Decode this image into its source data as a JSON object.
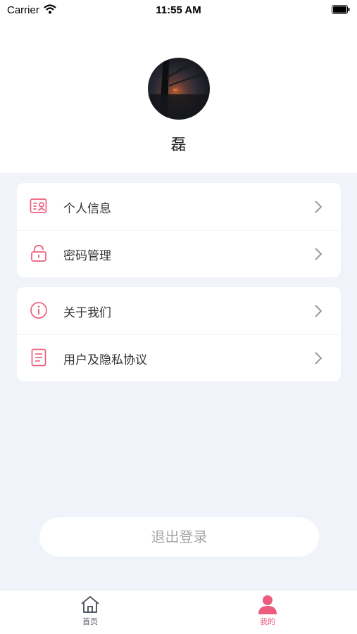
{
  "status_bar": {
    "carrier": "Carrier",
    "time": "11:55 AM"
  },
  "profile": {
    "name": "磊"
  },
  "menu": {
    "group1": [
      {
        "label": "个人信息",
        "icon": "profile-card-icon"
      },
      {
        "label": "密码管理",
        "icon": "lock-icon"
      }
    ],
    "group2": [
      {
        "label": "关于我们",
        "icon": "info-icon"
      },
      {
        "label": "用户及隐私协议",
        "icon": "document-icon"
      }
    ]
  },
  "logout_label": "退出登录",
  "tabbar": [
    {
      "label": "首页",
      "icon": "home-icon",
      "active": false
    },
    {
      "label": "我的",
      "icon": "person-icon",
      "active": true
    }
  ],
  "colors": {
    "accent": "#ee5c7c",
    "background": "#f0f3fa",
    "inactive_tab": "#555a66"
  }
}
